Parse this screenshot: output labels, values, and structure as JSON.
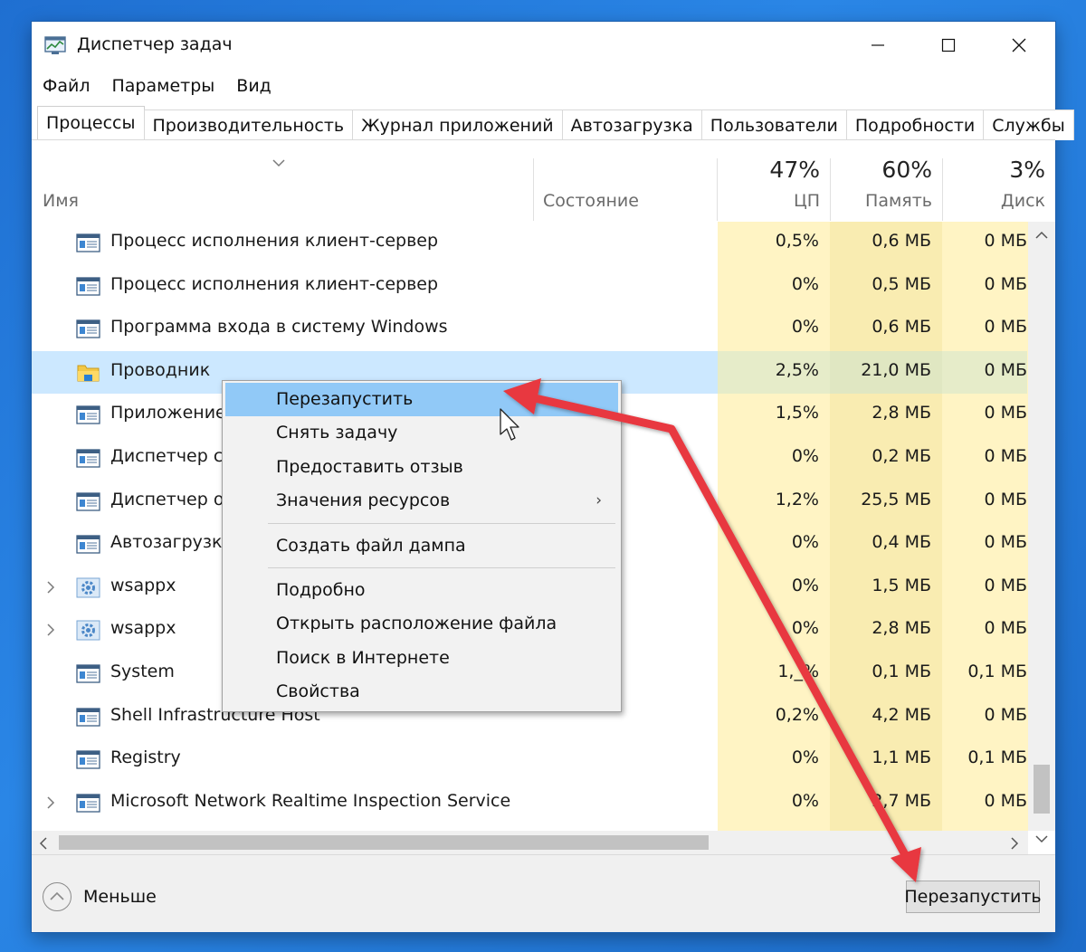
{
  "window": {
    "title": "Диспетчер задач",
    "minimize_icon": "minimize-icon",
    "maximize_icon": "maximize-icon",
    "close_icon": "close-icon"
  },
  "menu": [
    "Файл",
    "Параметры",
    "Вид"
  ],
  "tabs": [
    {
      "label": "Процессы",
      "active": true
    },
    {
      "label": "Производительность",
      "active": false
    },
    {
      "label": "Журнал приложений",
      "active": false
    },
    {
      "label": "Автозагрузка",
      "active": false
    },
    {
      "label": "Пользователи",
      "active": false
    },
    {
      "label": "Подробности",
      "active": false
    },
    {
      "label": "Службы",
      "active": false
    }
  ],
  "header": {
    "name": "Имя",
    "status": "Состояние",
    "cpu_pct": "47%",
    "cpu": "ЦП",
    "mem_pct": "60%",
    "mem": "Память",
    "disk_pct": "3%",
    "disk": "Диск"
  },
  "processes": [
    {
      "name": "Процесс исполнения клиент-сервер",
      "icon": "window-app-icon",
      "expandable": false,
      "cpu": "0,5%",
      "mem": "0,6 МБ",
      "disk": "0 МБ"
    },
    {
      "name": "Процесс исполнения клиент-сервер",
      "icon": "window-app-icon",
      "expandable": false,
      "cpu": "0%",
      "mem": "0,5 МБ",
      "disk": "0 МБ"
    },
    {
      "name": "Программа входа в систему Windows",
      "icon": "window-app-icon",
      "expandable": false,
      "cpu": "0%",
      "mem": "0,6 МБ",
      "disk": "0 МБ"
    },
    {
      "name": "Проводник",
      "icon": "explorer-folder-icon",
      "expandable": false,
      "selected": true,
      "cpu": "2,5%",
      "mem": "21,0 МБ",
      "disk": "0 МБ"
    },
    {
      "name": "Приложение",
      "icon": "window-app-icon",
      "expandable": false,
      "cpu": "1,5%",
      "mem": "2,8 МБ",
      "disk": "0 МБ"
    },
    {
      "name": "Диспетчер се",
      "icon": "window-app-icon",
      "expandable": false,
      "cpu": "0%",
      "mem": "0,2 МБ",
      "disk": "0 МБ"
    },
    {
      "name": "Диспетчер ок",
      "icon": "window-app-icon",
      "expandable": false,
      "cpu": "1,2%",
      "mem": "25,5 МБ",
      "disk": "0 МБ"
    },
    {
      "name": "Автозагрузка",
      "icon": "window-app-icon",
      "expandable": false,
      "cpu": "0%",
      "mem": "0,4 МБ",
      "disk": "0 МБ"
    },
    {
      "name": "wsappx",
      "icon": "gear-service-icon",
      "expandable": true,
      "cpu": "0%",
      "mem": "1,5 МБ",
      "disk": "0 МБ"
    },
    {
      "name": "wsappx",
      "icon": "gear-service-icon",
      "expandable": true,
      "cpu": "0%",
      "mem": "2,8 МБ",
      "disk": "0 МБ"
    },
    {
      "name": "System",
      "icon": "window-app-icon",
      "expandable": false,
      "cpu": "1,_%",
      "mem": "0,1 МБ",
      "disk": "0,1 МБ"
    },
    {
      "name": "Shell Infrastructure Host",
      "icon": "window-app-icon",
      "expandable": false,
      "cpu": "0,2%",
      "mem": "4,2 МБ",
      "disk": "0 МБ"
    },
    {
      "name": "Registry",
      "icon": "window-app-icon",
      "expandable": false,
      "cpu": "0%",
      "mem": "1,1 МБ",
      "disk": "0,1 МБ"
    },
    {
      "name": "Microsoft Network Realtime Inspection Service",
      "icon": "window-app-icon",
      "expandable": true,
      "cpu": "0%",
      "mem": "2,7 МБ",
      "disk": "0 МБ"
    }
  ],
  "context_menu": {
    "items": [
      {
        "label": "Перезапустить",
        "highlighted": true
      },
      {
        "label": "Снять задачу"
      },
      {
        "label": "Предоставить отзыв"
      },
      {
        "label": "Значения ресурсов",
        "submenu": true,
        "submenu_arrow": "›"
      },
      {
        "separator": true
      },
      {
        "label": "Создать файл дампа"
      },
      {
        "separator": true
      },
      {
        "label": "Подробно"
      },
      {
        "label": "Открыть расположение файла"
      },
      {
        "label": "Поиск в Интернете"
      },
      {
        "label": "Свойства"
      }
    ]
  },
  "footer": {
    "less_label": "Меньше",
    "restart_button": "Перезапустить"
  },
  "colors": {
    "heat_light": "#fff4c4",
    "heat_mid": "#f9ecb1",
    "selected_row": "#cce8ff",
    "context_highlight": "#91c9f7",
    "annotation_arrow": "#e8393f",
    "desktop": "#2a86e6"
  }
}
